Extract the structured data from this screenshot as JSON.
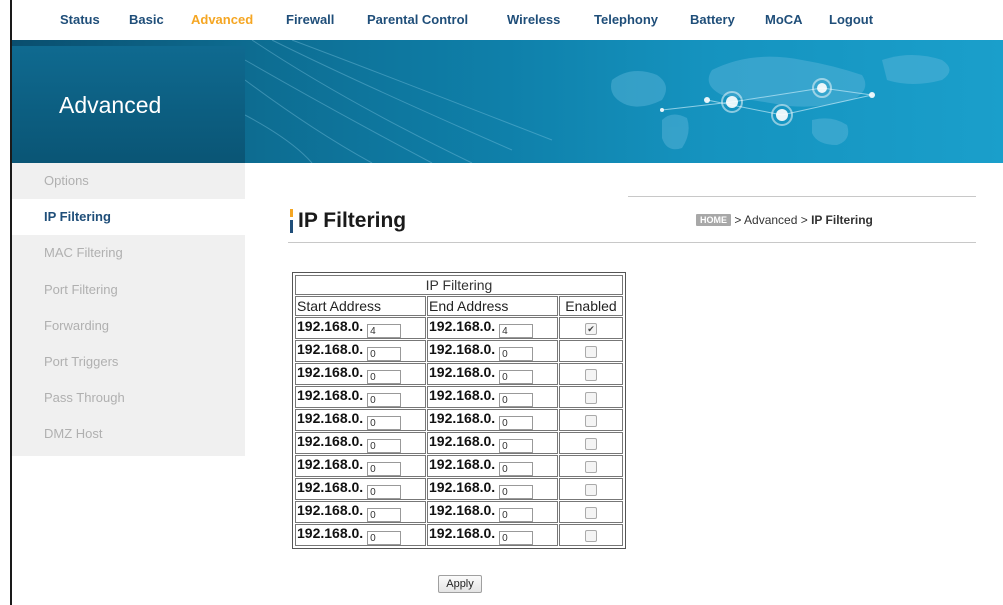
{
  "nav": {
    "items": [
      {
        "label": "Status",
        "active": false
      },
      {
        "label": "Basic",
        "active": false
      },
      {
        "label": "Advanced",
        "active": true
      },
      {
        "label": "Firewall",
        "active": false
      },
      {
        "label": "Parental Control",
        "active": false
      },
      {
        "label": "Wireless",
        "active": false
      },
      {
        "label": "Telephony",
        "active": false
      },
      {
        "label": "Battery",
        "active": false
      },
      {
        "label": "MoCA",
        "active": false
      },
      {
        "label": "Logout",
        "active": false
      }
    ]
  },
  "banner": {
    "title": "Advanced"
  },
  "sidebar": {
    "items": [
      {
        "label": "Options",
        "active": false
      },
      {
        "label": "IP Filtering",
        "active": true
      },
      {
        "label": "MAC Filtering",
        "active": false
      },
      {
        "label": "Port Filtering",
        "active": false
      },
      {
        "label": "Forwarding",
        "active": false
      },
      {
        "label": "Port Triggers",
        "active": false
      },
      {
        "label": "Pass Through",
        "active": false
      },
      {
        "label": "DMZ Host",
        "active": false
      }
    ]
  },
  "page": {
    "title": "IP Filtering"
  },
  "breadcrumb": {
    "home": "HOME",
    "sep1": " > ",
    "section": "Advanced",
    "sep2": " > ",
    "current": "IP Filtering"
  },
  "table": {
    "caption": "IP Filtering",
    "headers": [
      "Start Address",
      "End Address",
      "Enabled"
    ],
    "prefix": "192.168.0.",
    "rows": [
      {
        "start": "4",
        "end": "4",
        "enabled": true
      },
      {
        "start": "0",
        "end": "0",
        "enabled": false
      },
      {
        "start": "0",
        "end": "0",
        "enabled": false
      },
      {
        "start": "0",
        "end": "0",
        "enabled": false
      },
      {
        "start": "0",
        "end": "0",
        "enabled": false
      },
      {
        "start": "0",
        "end": "0",
        "enabled": false
      },
      {
        "start": "0",
        "end": "0",
        "enabled": false
      },
      {
        "start": "0",
        "end": "0",
        "enabled": false
      },
      {
        "start": "0",
        "end": "0",
        "enabled": false
      },
      {
        "start": "0",
        "end": "0",
        "enabled": false
      }
    ]
  },
  "apply_label": "Apply",
  "colors": {
    "nav_text": "#1f4e79",
    "accent": "#f5a623",
    "banner": "#0d6d92",
    "sidebar_bg": "#f0f0f0",
    "sidebar_text": "#b0b0b0"
  }
}
